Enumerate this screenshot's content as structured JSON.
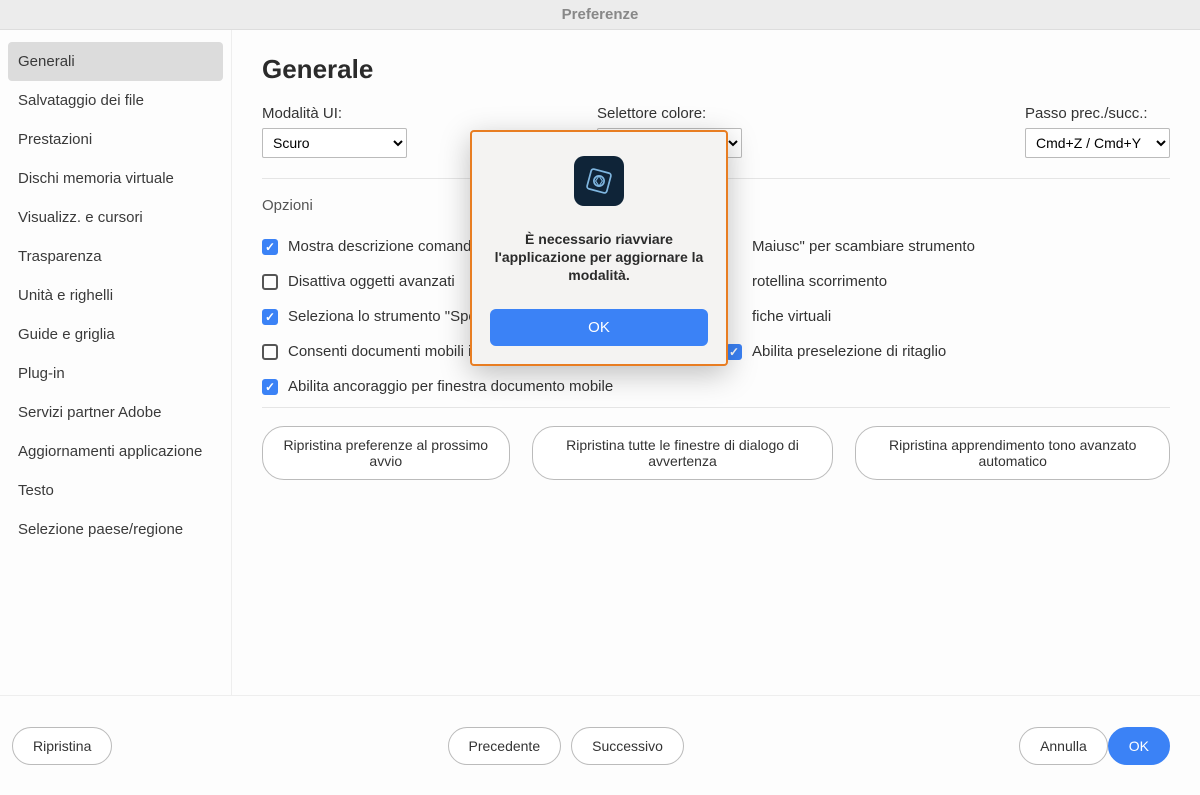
{
  "window": {
    "title": "Preferenze"
  },
  "sidebar": {
    "items": [
      {
        "label": "Generali",
        "active": true
      },
      {
        "label": "Salvataggio dei file",
        "active": false
      },
      {
        "label": "Prestazioni",
        "active": false
      },
      {
        "label": "Dischi memoria virtuale",
        "active": false
      },
      {
        "label": "Visualizz. e cursori",
        "active": false
      },
      {
        "label": "Trasparenza",
        "active": false
      },
      {
        "label": "Unità e righelli",
        "active": false
      },
      {
        "label": "Guide e griglia",
        "active": false
      },
      {
        "label": "Plug-in",
        "active": false
      },
      {
        "label": "Servizi partner Adobe",
        "active": false
      },
      {
        "label": "Aggiornamenti applicazione",
        "active": false
      },
      {
        "label": "Testo",
        "active": false
      },
      {
        "label": "Selezione paese/regione",
        "active": false
      }
    ]
  },
  "page": {
    "title": "Generale",
    "fields": {
      "ui_mode": {
        "label": "Modalità UI:",
        "value": "Scuro"
      },
      "color_picker": {
        "label": "Selettore colore:",
        "value": ""
      },
      "undo": {
        "label": "Passo prec./succ.:",
        "value": "Cmd+Z / Cmd+Y"
      }
    },
    "options_label": "Opzioni",
    "options": {
      "left": [
        {
          "label": "Mostra descrizione comandi",
          "checked": true
        },
        {
          "label": "Disattiva oggetti avanzati",
          "checked": false
        },
        {
          "label": "Seleziona lo strumento \"Sposta\" a",
          "checked": true
        },
        {
          "label": "Consenti documenti mobili in modalità avanzata",
          "checked": false
        },
        {
          "label": "Abilita ancoraggio per finestra documento mobile",
          "checked": true
        }
      ],
      "right": [
        {
          "label": "Maiusc\" per scambiare strumento",
          "checked": false,
          "hidden_cb": true
        },
        {
          "label": "rotellina scorrimento",
          "checked": false,
          "hidden_cb": true
        },
        {
          "label": "fiche virtuali",
          "checked": false,
          "hidden_cb": true
        },
        {
          "label": "Abilita preselezione di ritaglio",
          "checked": true,
          "hidden_cb": false
        }
      ]
    },
    "reset_buttons": [
      "Ripristina preferenze al prossimo avvio",
      "Ripristina tutte le finestre di dialogo di avvertenza",
      "Ripristina apprendimento tono avanzato automatico"
    ]
  },
  "footer": {
    "reset": "Ripristina",
    "prev": "Precedente",
    "next": "Successivo",
    "cancel": "Annulla",
    "ok": "OK"
  },
  "modal": {
    "message": "È necessario riavviare l'applicazione per aggiornare la modalità.",
    "ok": "OK"
  }
}
